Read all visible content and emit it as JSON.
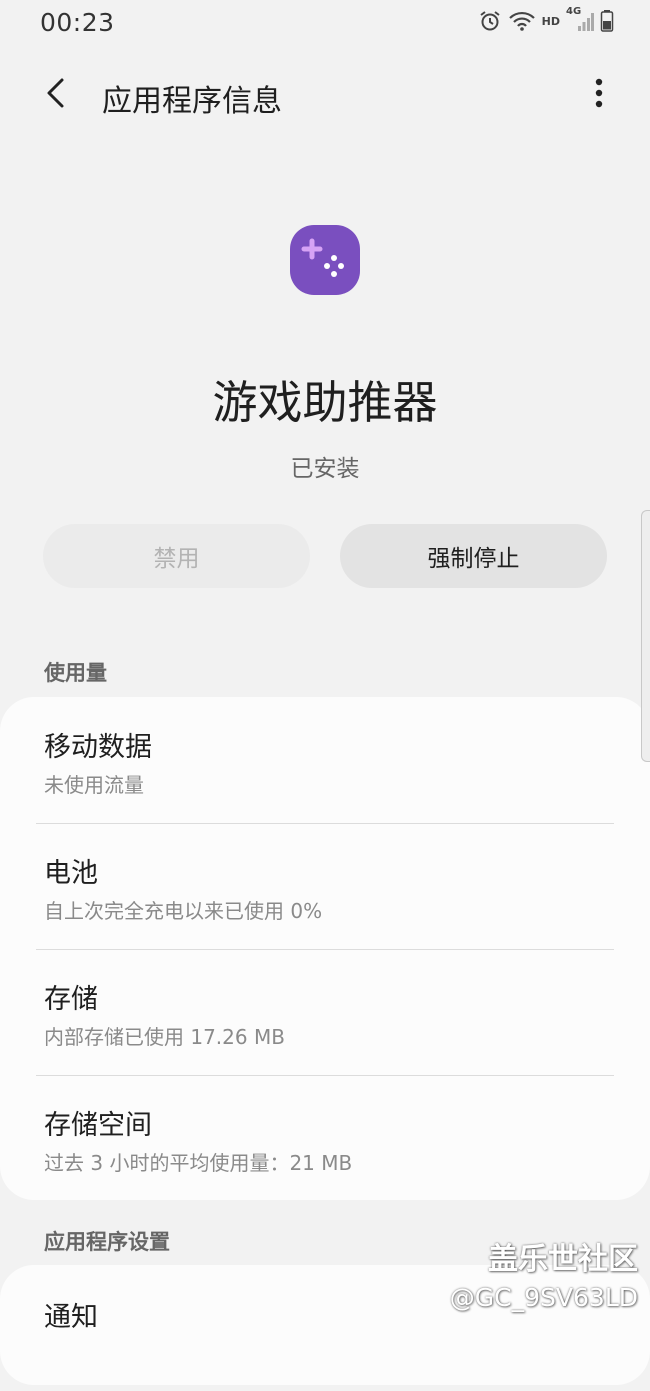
{
  "status_bar": {
    "time": "00:23",
    "hd_label": "HD",
    "network_label": "4G"
  },
  "header": {
    "title": "应用程序信息"
  },
  "app": {
    "name": "游戏助推器",
    "status": "已安装",
    "icon_name": "game-controller-icon",
    "icon_color": "#7a4fbf"
  },
  "buttons": {
    "disable_label": "禁用",
    "force_stop_label": "强制停止"
  },
  "usage_section": {
    "header": "使用量",
    "items": [
      {
        "title": "移动数据",
        "subtitle": "未使用流量"
      },
      {
        "title": "电池",
        "subtitle": "自上次完全充电以来已使用 0%"
      },
      {
        "title": "存储",
        "subtitle": "内部存储已使用 17.26 MB"
      },
      {
        "title": "存储空间",
        "subtitle": "过去 3 小时的平均使用量：21 MB"
      }
    ]
  },
  "settings_section": {
    "header": "应用程序设置",
    "items": [
      {
        "title": "通知"
      }
    ]
  },
  "watermark": {
    "line1": "盖乐世社区",
    "line2": "@GC_9SV63LD"
  }
}
